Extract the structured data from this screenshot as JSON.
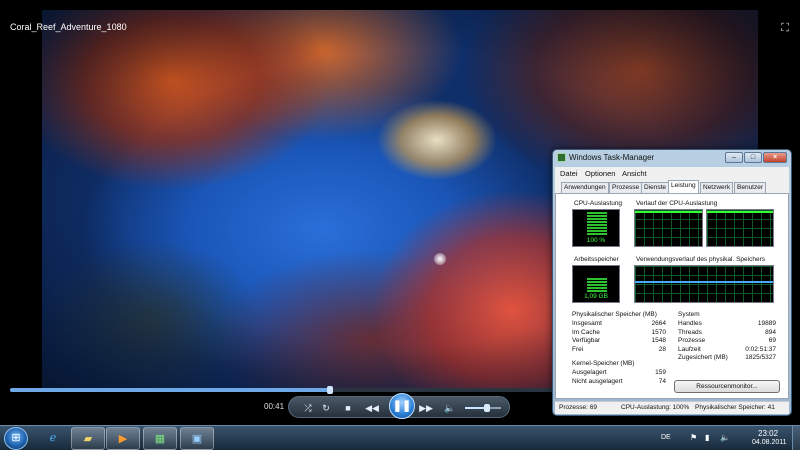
{
  "player": {
    "title": "Coral_Reef_Adventure_1080",
    "current_time": "00:41",
    "progress": 0.41,
    "volume": 0.6,
    "icons": {
      "fullscreen": "fullscreen-icon",
      "shuffle": "shuffle-icon",
      "repeat": "repeat-icon",
      "stop": "stop-icon",
      "previous": "previous-icon",
      "play_pause": "pause-icon",
      "next": "next-icon",
      "mute": "speaker-icon"
    }
  },
  "taskmgr": {
    "title": "Windows Task-Manager",
    "window_buttons": [
      "–",
      "□",
      "×"
    ],
    "menu": [
      "Datei",
      "Optionen",
      "Ansicht"
    ],
    "tabs": [
      "Anwendungen",
      "Prozesse",
      "Dienste",
      "Leistung",
      "Netzwerk",
      "Benutzer"
    ],
    "active_tab": "Leistung",
    "cpu_usage_label": "CPU-Auslastung",
    "cpu_usage_value": "100 %",
    "cpu_usage_fraction": 1.0,
    "cpu_history_label": "Verlauf der CPU-Auslastung",
    "memory_label": "Arbeitsspeicher",
    "memory_value": "1,09 GB",
    "memory_fraction": 0.58,
    "memory_history_label": "Verwendungsverlauf des physikal. Speichers",
    "physical_memory": {
      "heading": "Physikalischer Speicher (MB)",
      "rows": [
        {
          "key": "Insgesamt",
          "value": "2664"
        },
        {
          "key": "Im Cache",
          "value": "1570"
        },
        {
          "key": "Verfügbar",
          "value": "1548"
        },
        {
          "key": "Frei",
          "value": "28"
        }
      ]
    },
    "kernel_memory": {
      "heading": "Kernel-Speicher (MB)",
      "rows": [
        {
          "key": "Ausgelagert",
          "value": "159"
        },
        {
          "key": "Nicht ausgelagert",
          "value": "74"
        }
      ]
    },
    "system": {
      "heading": "System",
      "rows": [
        {
          "key": "Handles",
          "value": "19889"
        },
        {
          "key": "Threads",
          "value": "894"
        },
        {
          "key": "Prozesse",
          "value": "69"
        },
        {
          "key": "Laufzeit",
          "value": "0:02:51:37"
        },
        {
          "key": "Zugesichert (MB)",
          "value": "1825/5327"
        }
      ]
    },
    "resource_monitor_button": "Ressourcenmonitor...",
    "status": {
      "processes": "Prozesse: 69",
      "cpu": "CPU-Auslastung: 100%",
      "memory": "Physikalischer Speicher: 41"
    }
  },
  "taskbar": {
    "start_icon": "windows-logo-icon",
    "buttons": [
      {
        "icon": "internet-explorer-icon",
        "state": "pinned"
      },
      {
        "icon": "folder-icon",
        "state": "running"
      },
      {
        "icon": "media-player-icon",
        "state": "running"
      },
      {
        "icon": "task-manager-icon",
        "state": "running"
      },
      {
        "icon": "remote-desktop-icon",
        "state": "running"
      }
    ],
    "tray": {
      "language": "DE",
      "icons": [
        "flag-icon",
        "network-icon",
        "volume-icon"
      ]
    },
    "clock": {
      "time": "23:02",
      "date": "04.08.2011"
    }
  }
}
